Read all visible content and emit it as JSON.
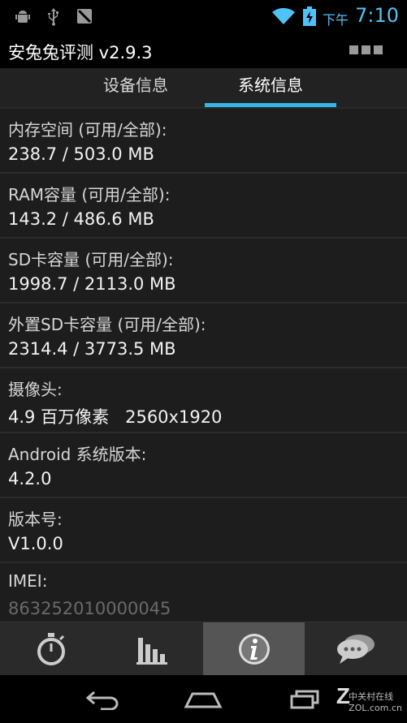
{
  "status_bar": {
    "ampm": "下午",
    "time": "7:10",
    "icons": [
      "android-debug-icon",
      "usb-icon",
      "no-sim-icon",
      "wifi-icon",
      "battery-charging-icon"
    ],
    "accent_color": "#4fc3f7"
  },
  "app": {
    "title": "安兔兔评测 v2.9.3"
  },
  "tabs": [
    {
      "label": "设备信息",
      "selected": false
    },
    {
      "label": "系统信息",
      "selected": true
    }
  ],
  "tab_accent": "#33b5e5",
  "info": [
    {
      "label": "内存空间 (可用/全部):",
      "value": "238.7 / 503.0 MB"
    },
    {
      "label": "RAM容量 (可用/全部):",
      "value": "143.2 / 486.6 MB"
    },
    {
      "label": "SD卡容量 (可用/全部):",
      "value": "1998.7 / 2113.0 MB"
    },
    {
      "label": "外置SD卡容量 (可用/全部):",
      "value": "2314.4 / 3773.5 MB"
    },
    {
      "label": "摄像头:",
      "value": "4.9 百万像素   2560x1920"
    },
    {
      "label": "Android 系统版本:",
      "value": "4.2.0"
    },
    {
      "label": "版本号:",
      "value": "V1.0.0"
    },
    {
      "label": "IMEI:",
      "value": "863252010000045"
    }
  ],
  "toolbar": {
    "items": [
      "stopwatch-icon",
      "bar-chart-icon",
      "info-icon",
      "chat-bubble-icon"
    ],
    "active_index": 2
  },
  "nav": {
    "watermark_top": "中关村在线",
    "watermark_bottom": "ZOL.com.cn",
    "watermark_letter": "Z"
  }
}
